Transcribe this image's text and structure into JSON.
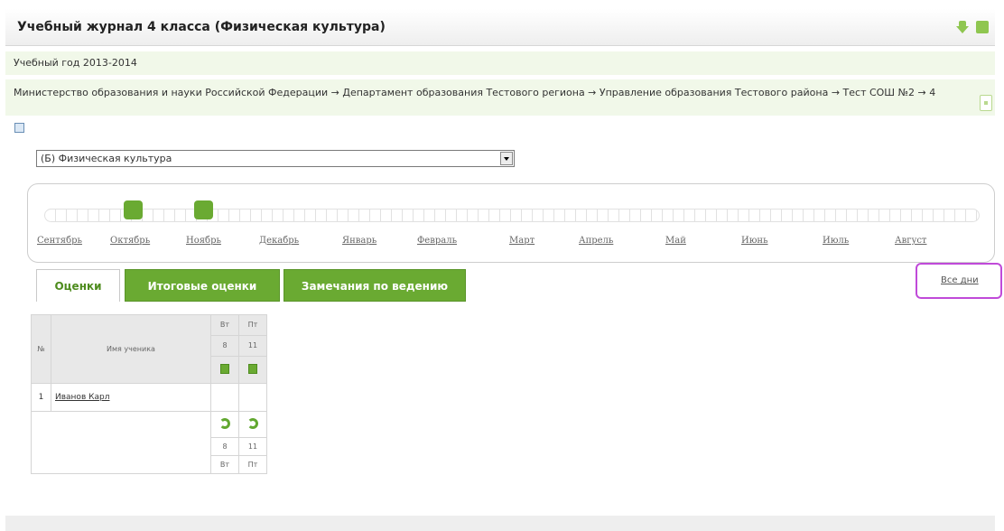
{
  "header": {
    "title": "Учебный журнал 4 класса (Физическая культура)",
    "icons": [
      "download-icon",
      "save-icon"
    ]
  },
  "year": "Учебный год 2013-2014",
  "path": "Министерство образования и науки Российской Федерации → Департамент образования Тестового региона → Управление образования Тестового района → Тест СОШ №2 → 4",
  "subject_select": {
    "value": "(Б) Физическая культура"
  },
  "months": [
    "Сентябрь",
    "Октябрь",
    "Ноябрь",
    "Декабрь",
    "Январь",
    "Февраль",
    "Март",
    "Апрель",
    "Май",
    "Июнь",
    "Июль",
    "Август"
  ],
  "tabs": [
    "Оценки",
    "Итоговые оценки",
    "Замечания по ведению журнала"
  ],
  "all_days": "Все дни",
  "grid": {
    "num_header": "№",
    "name_header": "Имя ученика",
    "days": [
      {
        "weekday": "Вт",
        "date": "8"
      },
      {
        "weekday": "Пт",
        "date": "11"
      }
    ],
    "rows": [
      {
        "num": "1",
        "name": "Иванов Карл"
      }
    ]
  },
  "colors": {
    "accent": "#6aaa32",
    "panel_bg": "#f1f8e9",
    "highlight": "#c04ad9"
  }
}
